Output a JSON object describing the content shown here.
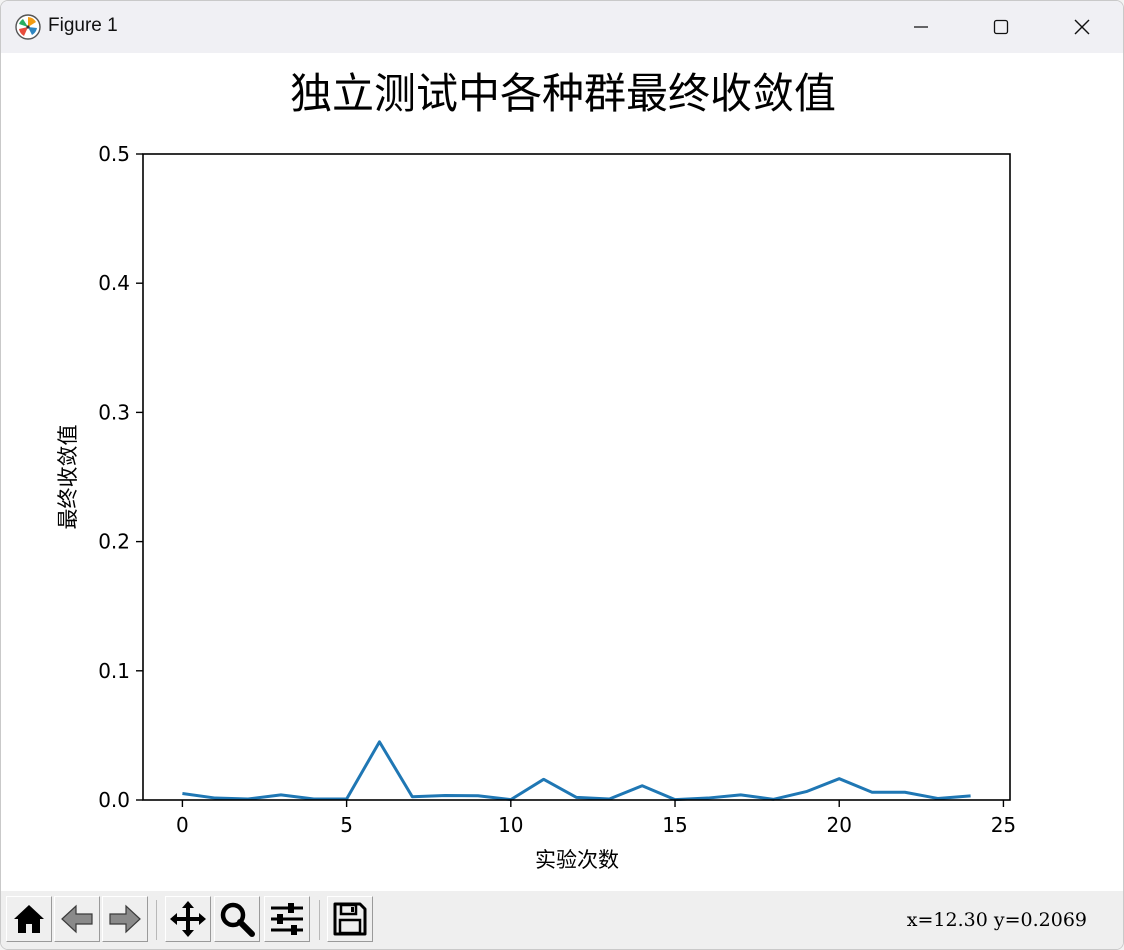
{
  "window": {
    "title": "Figure 1"
  },
  "status": {
    "text": "x=12.30 y=0.2069"
  },
  "toolbar": {
    "buttons": [
      {
        "id": "home",
        "icon": "home-icon"
      },
      {
        "id": "back",
        "icon": "left-arrow-icon"
      },
      {
        "id": "forward",
        "icon": "right-arrow-icon"
      },
      {
        "id": "pan",
        "icon": "move-icon"
      },
      {
        "id": "zoom",
        "icon": "search-icon"
      },
      {
        "id": "configure",
        "icon": "sliders-icon"
      },
      {
        "id": "save",
        "icon": "floppy-disk-icon"
      }
    ]
  },
  "colors": {
    "line": "#1f77b4",
    "titlebar": "#f0f0f4",
    "toolbar": "#efefef"
  },
  "chart_data": {
    "type": "line",
    "title": "独立测试中各种群最终收敛值",
    "xlabel": "实验次数",
    "ylabel": "最终收敛值",
    "xlim": [
      -1.2,
      25.2
    ],
    "ylim": [
      0,
      0.5
    ],
    "xticks": [
      0,
      5,
      10,
      15,
      20,
      25
    ],
    "xtick_labels": [
      "0",
      "5",
      "10",
      "15",
      "20",
      "25"
    ],
    "yticks": [
      0.0,
      0.1,
      0.2,
      0.3,
      0.4,
      0.5
    ],
    "ytick_labels": [
      "0.0",
      "0.1",
      "0.2",
      "0.3",
      "0.4",
      "0.5"
    ],
    "grid": false,
    "series": [
      {
        "x": [
          0,
          1,
          2,
          3,
          4,
          5,
          6,
          7,
          8,
          9,
          10,
          11,
          12,
          13,
          14,
          15,
          16,
          17,
          18,
          19,
          20,
          21,
          22,
          23,
          24
        ],
        "y": [
          0.005,
          0.0015,
          0.0008,
          0.004,
          0.0008,
          0.0008,
          0.045,
          0.0025,
          0.0035,
          0.0033,
          0.0003,
          0.016,
          0.002,
          0.0008,
          0.011,
          0.0003,
          0.0015,
          0.004,
          0.0005,
          0.0065,
          0.0165,
          0.006,
          0.006,
          0.0012,
          0.0032
        ]
      }
    ]
  }
}
